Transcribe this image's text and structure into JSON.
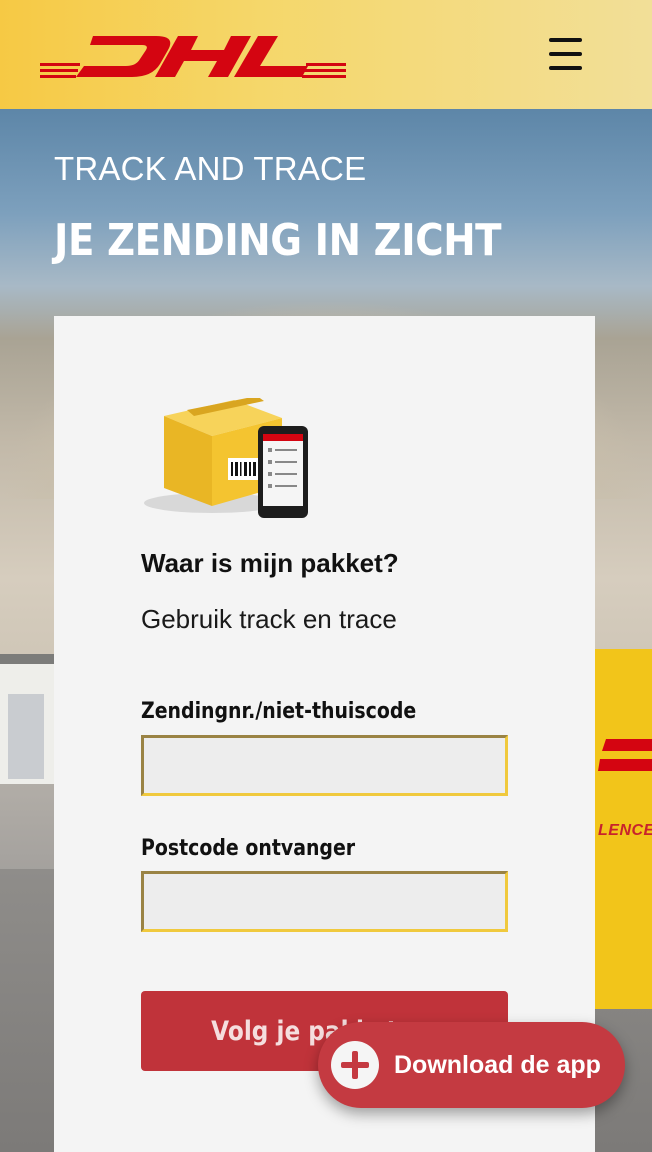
{
  "header": {
    "logo_alt": "DHL",
    "menu_icon": "hamburger-icon",
    "colors": {
      "background": "#f6c944",
      "logo": "#d40511"
    }
  },
  "hero": {
    "eyebrow": "TRACK AND TRACE",
    "headline": "JE ZENDING IN ZICHT",
    "van_text": "LENCE"
  },
  "card": {
    "illustration_icon": "package-with-phone-icon",
    "title": "Waar is mijn pakket?",
    "subtitle": "Gebruik track en trace",
    "fields": [
      {
        "label": "Zendingnr./niet-thuiscode",
        "value": "",
        "placeholder": ""
      },
      {
        "label": "Postcode ontvanger",
        "value": "",
        "placeholder": ""
      }
    ],
    "submit_label": "Volg je pakket",
    "submit_color": "#c0333a"
  },
  "fab": {
    "label": "Download de app",
    "icon": "plus-circle-icon",
    "color": "#c43a41"
  }
}
